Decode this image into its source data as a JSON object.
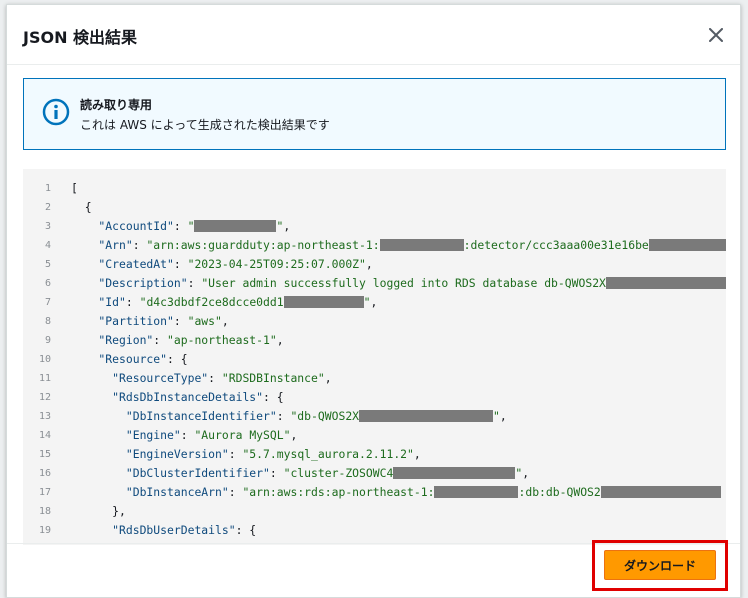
{
  "modal": {
    "title": "JSON 検出結果"
  },
  "alert": {
    "title": "読み取り専用",
    "body": "これは AWS によって生成された検出結果です"
  },
  "footer": {
    "download_label": "ダウンロード"
  },
  "code_lines": [
    {
      "n": "1",
      "parts": [
        [
          "p",
          "["
        ]
      ]
    },
    {
      "n": "2",
      "parts": [
        [
          "p",
          "  {"
        ]
      ]
    },
    {
      "n": "3",
      "parts": [
        [
          "k",
          "    \"AccountId\""
        ],
        [
          "p",
          ": "
        ],
        [
          "s",
          "\""
        ],
        [
          "r",
          82
        ],
        [
          "s",
          "\""
        ],
        [
          "p",
          ","
        ]
      ]
    },
    {
      "n": "4",
      "parts": [
        [
          "k",
          "    \"Arn\""
        ],
        [
          "p",
          ": "
        ],
        [
          "s",
          "\"arn:aws:guardduty:ap-northeast-1:"
        ],
        [
          "r",
          84
        ],
        [
          "s",
          ":detector/ccc3aaa00e31e16be"
        ],
        [
          "r",
          90
        ]
      ]
    },
    {
      "n": "5",
      "parts": [
        [
          "k",
          "    \"CreatedAt\""
        ],
        [
          "p",
          ": "
        ],
        [
          "s",
          "\"2023-04-25T09:25:07.000Z\""
        ],
        [
          "p",
          ","
        ]
      ]
    },
    {
      "n": "6",
      "parts": [
        [
          "k",
          "    \"Description\""
        ],
        [
          "p",
          ": "
        ],
        [
          "s",
          "\"User admin successfully logged into RDS database db-QWOS2X"
        ],
        [
          "r",
          130
        ]
      ]
    },
    {
      "n": "7",
      "parts": [
        [
          "k",
          "    \"Id\""
        ],
        [
          "p",
          ": "
        ],
        [
          "s",
          "\"d4c3dbdf2ce8dcce0dd1"
        ],
        [
          "r",
          80
        ],
        [
          "s",
          "\""
        ],
        [
          "p",
          ","
        ]
      ]
    },
    {
      "n": "8",
      "parts": [
        [
          "k",
          "    \"Partition\""
        ],
        [
          "p",
          ": "
        ],
        [
          "s",
          "\"aws\""
        ],
        [
          "p",
          ","
        ]
      ]
    },
    {
      "n": "9",
      "parts": [
        [
          "k",
          "    \"Region\""
        ],
        [
          "p",
          ": "
        ],
        [
          "s",
          "\"ap-northeast-1\""
        ],
        [
          "p",
          ","
        ]
      ]
    },
    {
      "n": "10",
      "parts": [
        [
          "k",
          "    \"Resource\""
        ],
        [
          "p",
          ": {"
        ]
      ]
    },
    {
      "n": "11",
      "parts": [
        [
          "k",
          "      \"ResourceType\""
        ],
        [
          "p",
          ": "
        ],
        [
          "s",
          "\"RDSDBInstance\""
        ],
        [
          "p",
          ","
        ]
      ]
    },
    {
      "n": "12",
      "parts": [
        [
          "k",
          "      \"RdsDbInstanceDetails\""
        ],
        [
          "p",
          ": {"
        ]
      ]
    },
    {
      "n": "13",
      "parts": [
        [
          "k",
          "        \"DbInstanceIdentifier\""
        ],
        [
          "p",
          ": "
        ],
        [
          "s",
          "\"db-QWOS2X"
        ],
        [
          "r",
          134
        ],
        [
          "s",
          "\""
        ],
        [
          "p",
          ","
        ]
      ]
    },
    {
      "n": "14",
      "parts": [
        [
          "k",
          "        \"Engine\""
        ],
        [
          "p",
          ": "
        ],
        [
          "s",
          "\"Aurora MySQL\""
        ],
        [
          "p",
          ","
        ]
      ]
    },
    {
      "n": "15",
      "parts": [
        [
          "k",
          "        \"EngineVersion\""
        ],
        [
          "p",
          ": "
        ],
        [
          "s",
          "\"5.7.mysql_aurora.2.11.2\""
        ],
        [
          "p",
          ","
        ]
      ]
    },
    {
      "n": "16",
      "parts": [
        [
          "k",
          "        \"DbClusterIdentifier\""
        ],
        [
          "p",
          ": "
        ],
        [
          "s",
          "\"cluster-ZOSOWC4"
        ],
        [
          "r",
          122
        ],
        [
          "s",
          "\""
        ],
        [
          "p",
          ","
        ]
      ]
    },
    {
      "n": "17",
      "parts": [
        [
          "k",
          "        \"DbInstanceArn\""
        ],
        [
          "p",
          ": "
        ],
        [
          "s",
          "\"arn:aws:rds:ap-northeast-1:"
        ],
        [
          "r",
          84
        ],
        [
          "s",
          ":db:db-QWOS2"
        ],
        [
          "r",
          120
        ]
      ]
    },
    {
      "n": "18",
      "parts": [
        [
          "p",
          "      },"
        ]
      ]
    },
    {
      "n": "19",
      "parts": [
        [
          "k",
          "      \"RdsDbUserDetails\""
        ],
        [
          "p",
          ": {"
        ]
      ]
    }
  ]
}
